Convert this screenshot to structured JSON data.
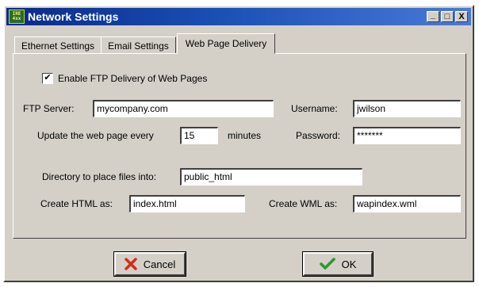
{
  "window": {
    "app_icon_text": "IRE 4xx",
    "title": "Network Settings",
    "controls": {
      "minimize": "_",
      "maximize": "□",
      "close": "X"
    }
  },
  "tabs": [
    {
      "label": "Ethernet Settings",
      "active": false
    },
    {
      "label": "Email Settings",
      "active": false
    },
    {
      "label": "Web Page Delivery",
      "active": true
    }
  ],
  "form": {
    "enable_ftp": {
      "label": "Enable FTP Delivery of Web Pages",
      "checked": true,
      "mark": "✔"
    },
    "ftp_server": {
      "label": "FTP Server:",
      "value": "mycompany.com"
    },
    "username": {
      "label": "Username:",
      "value": "jwilson"
    },
    "update_every": {
      "label": "Update the web page every",
      "value": "15",
      "unit": "minutes"
    },
    "password": {
      "label": "Password:",
      "value": "*******"
    },
    "directory": {
      "label": "Directory to place files into:",
      "value": "public_html"
    },
    "html_name": {
      "label": "Create HTML as:",
      "value": "index.html"
    },
    "wml_name": {
      "label": "Create WML as:",
      "value": "wapindex.wml"
    }
  },
  "buttons": {
    "cancel": {
      "label": "Cancel",
      "icon": "red-x-icon",
      "icon_color": "#d42a1a"
    },
    "ok": {
      "label": "OK",
      "icon": "green-check-icon",
      "icon_color": "#2a9a2a"
    }
  }
}
